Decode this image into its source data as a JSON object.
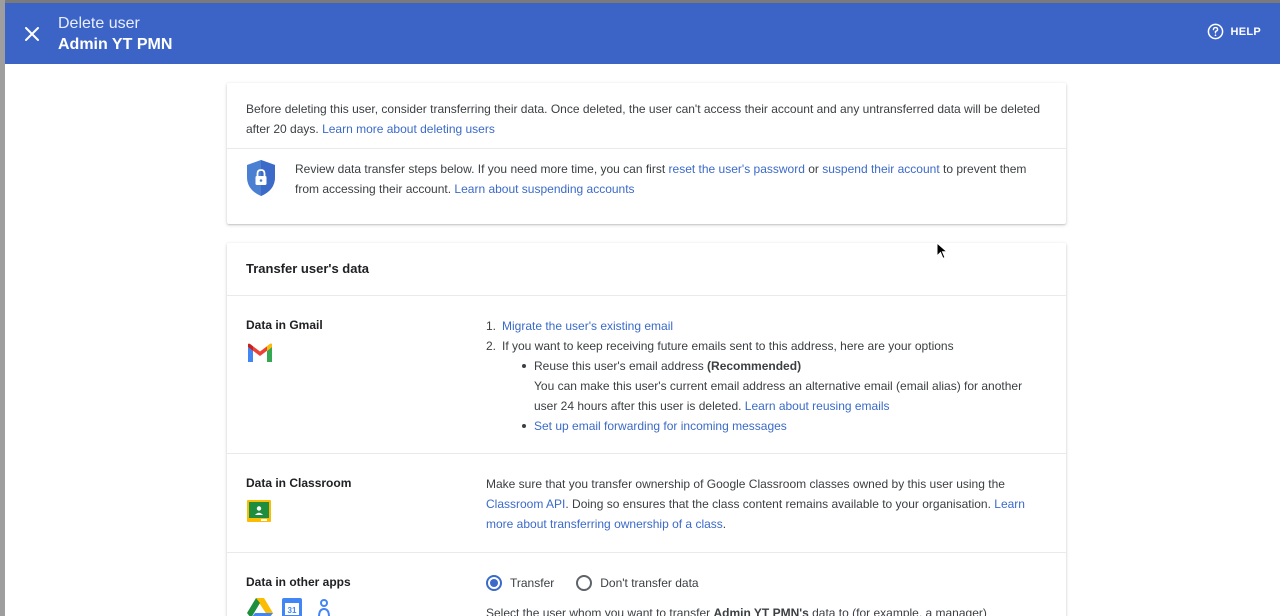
{
  "header": {
    "subtitle": "Delete user",
    "title": "Admin YT PMN",
    "help_label": "HELP"
  },
  "intro": {
    "text": "Before deleting this user, consider transferring their data. Once deleted, the user can't access their account and any untransferred data will be deleted after 20 days.",
    "learn_more_link": "Learn more about deleting users"
  },
  "review": {
    "text1": "Review data transfer steps below. If you need more time, you can first",
    "reset_link": "reset the user's password",
    "or": "or",
    "suspend_link": "suspend their account",
    "text2": "to prevent them from accessing their account.",
    "learn_suspend_link": "Learn about suspending accounts"
  },
  "transfer": {
    "title": "Transfer user's data",
    "gmail": {
      "label": "Data in Gmail",
      "step1_num": "1.",
      "step1_link": "Migrate the user's existing email",
      "step2_num": "2.",
      "step2_text": "If you want to keep receiving future emails sent to this address, here are your options",
      "option1_title": "Reuse this user's email address",
      "option1_badge": "(Recommended)",
      "option1_desc": "You can make this user's current email address an alternative email (email alias) for another user 24 hours after this user is deleted.",
      "option1_link": "Learn about reusing emails",
      "option2_link": "Set up email forwarding for incoming messages"
    },
    "classroom": {
      "label": "Data in Classroom",
      "text1": "Make sure that you transfer ownership of Google Classroom classes owned by this user using the",
      "api_link": "Classroom API",
      "text2": ". Doing so ensures that the class content remains available to your organisation.",
      "learn_link": "Learn more about transferring ownership of a class"
    },
    "other": {
      "label": "Data in other apps",
      "radio_transfer": "Transfer",
      "radio_dont": "Don't transfer data",
      "selected": "Transfer",
      "select_text_pre": "Select the user whom you want to transfer",
      "select_user": "Admin YT PMN's",
      "select_text_post": "data to (for example, a manager)"
    }
  },
  "colors": {
    "header_bg": "#3c63c6",
    "link": "#3b6ac9",
    "shield": "#4a7fd1"
  }
}
